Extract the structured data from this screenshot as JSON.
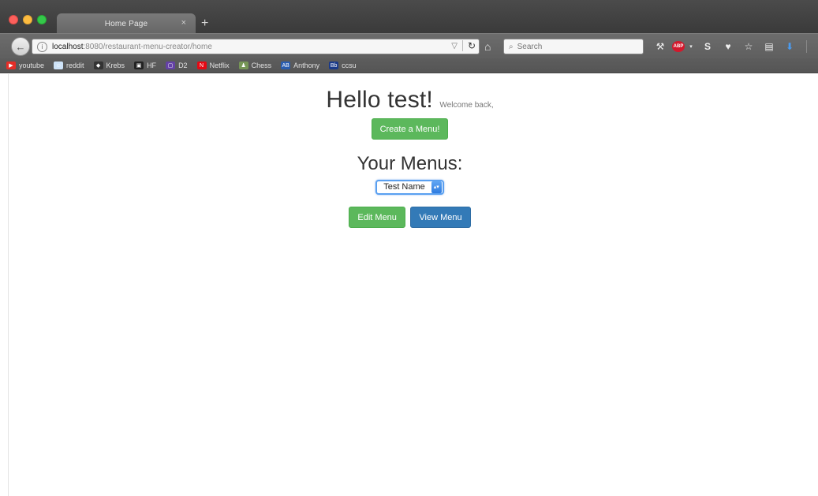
{
  "browser": {
    "tab": {
      "title": "Home Page",
      "close": "×"
    },
    "new_tab": "+",
    "url": {
      "host": "localhost",
      "rest": ":8080/restaurant-menu-creator/home"
    },
    "search": {
      "placeholder": "Search"
    },
    "bookmarks": [
      {
        "label": "youtube",
        "icon": "youtube-icon",
        "color": "#e52d27"
      },
      {
        "label": "reddit",
        "icon": "reddit-icon",
        "color": "#cee3f8"
      },
      {
        "label": "Krebs",
        "icon": "krebs-icon",
        "color": "#333333"
      },
      {
        "label": "HF",
        "icon": "hf-icon",
        "color": "#222222"
      },
      {
        "label": "D2",
        "icon": "twitch-icon",
        "color": "#6441a5"
      },
      {
        "label": "Netflix",
        "icon": "netflix-icon",
        "color": "#e50914"
      },
      {
        "label": "Chess",
        "icon": "chess-icon",
        "color": "#769656"
      },
      {
        "label": "Anthony",
        "icon": "anthony-icon",
        "color": "#2a5db0"
      },
      {
        "label": "ccsu",
        "icon": "ccsu-icon",
        "color": "#1a3a8a"
      }
    ]
  },
  "page": {
    "heading": "Hello test!",
    "welcome": "Welcome back,",
    "create_button": "Create a Menu!",
    "menus_title": "Your Menus:",
    "menu_select": {
      "selected": "Test Name"
    },
    "edit_button": "Edit Menu",
    "view_button": "View Menu"
  },
  "colors": {
    "success": "#5cb85c",
    "primary": "#337ab7"
  }
}
